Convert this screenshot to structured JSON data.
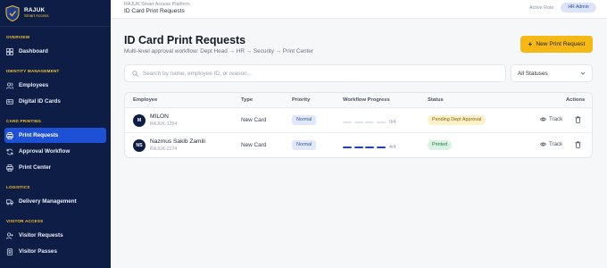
{
  "brand": {
    "title": "RAJUK",
    "subtitle": "Smart Access"
  },
  "sidebar": {
    "sections": [
      {
        "label": "OVERVIEW",
        "items": [
          {
            "label": "Dashboard",
            "icon": "grid-icon",
            "active": false
          }
        ]
      },
      {
        "label": "IDENTITY MANAGEMENT",
        "items": [
          {
            "label": "Employees",
            "icon": "users-icon",
            "active": false
          },
          {
            "label": "Digital ID Cards",
            "icon": "id-card-icon",
            "active": false
          }
        ]
      },
      {
        "label": "CARD PRINTING",
        "items": [
          {
            "label": "Print Requests",
            "icon": "printer-icon",
            "active": true
          },
          {
            "label": "Approval Workflow",
            "icon": "refresh-icon",
            "active": false
          },
          {
            "label": "Print Center",
            "icon": "printer-icon",
            "active": false
          }
        ]
      },
      {
        "label": "LOGISTICS",
        "items": [
          {
            "label": "Delivery Management",
            "icon": "truck-icon",
            "active": false
          }
        ]
      },
      {
        "label": "VISITOR ACCESS",
        "items": [
          {
            "label": "Visitor Requests",
            "icon": "user-plus-icon",
            "active": false
          },
          {
            "label": "Visitor Passes",
            "icon": "badge-icon",
            "active": false
          }
        ]
      }
    ]
  },
  "topbar": {
    "platform": "RAJUK Smart Access Platform",
    "page": "ID Card Print Requests",
    "role_label": "Active Role:",
    "role_value": "HR Admin"
  },
  "main": {
    "title": "ID Card Print Requests",
    "subtitle": "Multi-level approval workflow: Dept Head → HR → Security → Print Center",
    "new_button": "New Print Request",
    "search_placeholder": "Search by name, employee ID, or reason...",
    "status_filter": "All Statuses"
  },
  "table": {
    "headers": {
      "employee": "Employee",
      "type": "Type",
      "priority": "Priority",
      "progress": "Workflow Progress",
      "status": "Status",
      "actions": "Actions"
    },
    "rows": [
      {
        "initials": "M",
        "name": "MILON",
        "emp_id": "RAJUK-1254",
        "type": "New Card",
        "priority": "Normal",
        "steps_done": 0,
        "steps_total": 4,
        "progress_text": "0/4",
        "status": "Pending Dept Approval",
        "status_kind": "pending",
        "track": "Track"
      },
      {
        "initials": "NS",
        "name": "Nazmus Sakib Zamili",
        "emp_id": "RAJUK-2274",
        "type": "New Card",
        "priority": "Normal",
        "steps_done": 4,
        "steps_total": 4,
        "progress_text": "4/4",
        "status": "Printed",
        "status_kind": "printed",
        "track": "Track"
      }
    ]
  },
  "colors": {
    "sidebar_bg": "#0d1d45",
    "accent_blue": "#1e50d6",
    "accent_yellow": "#f5b814"
  }
}
